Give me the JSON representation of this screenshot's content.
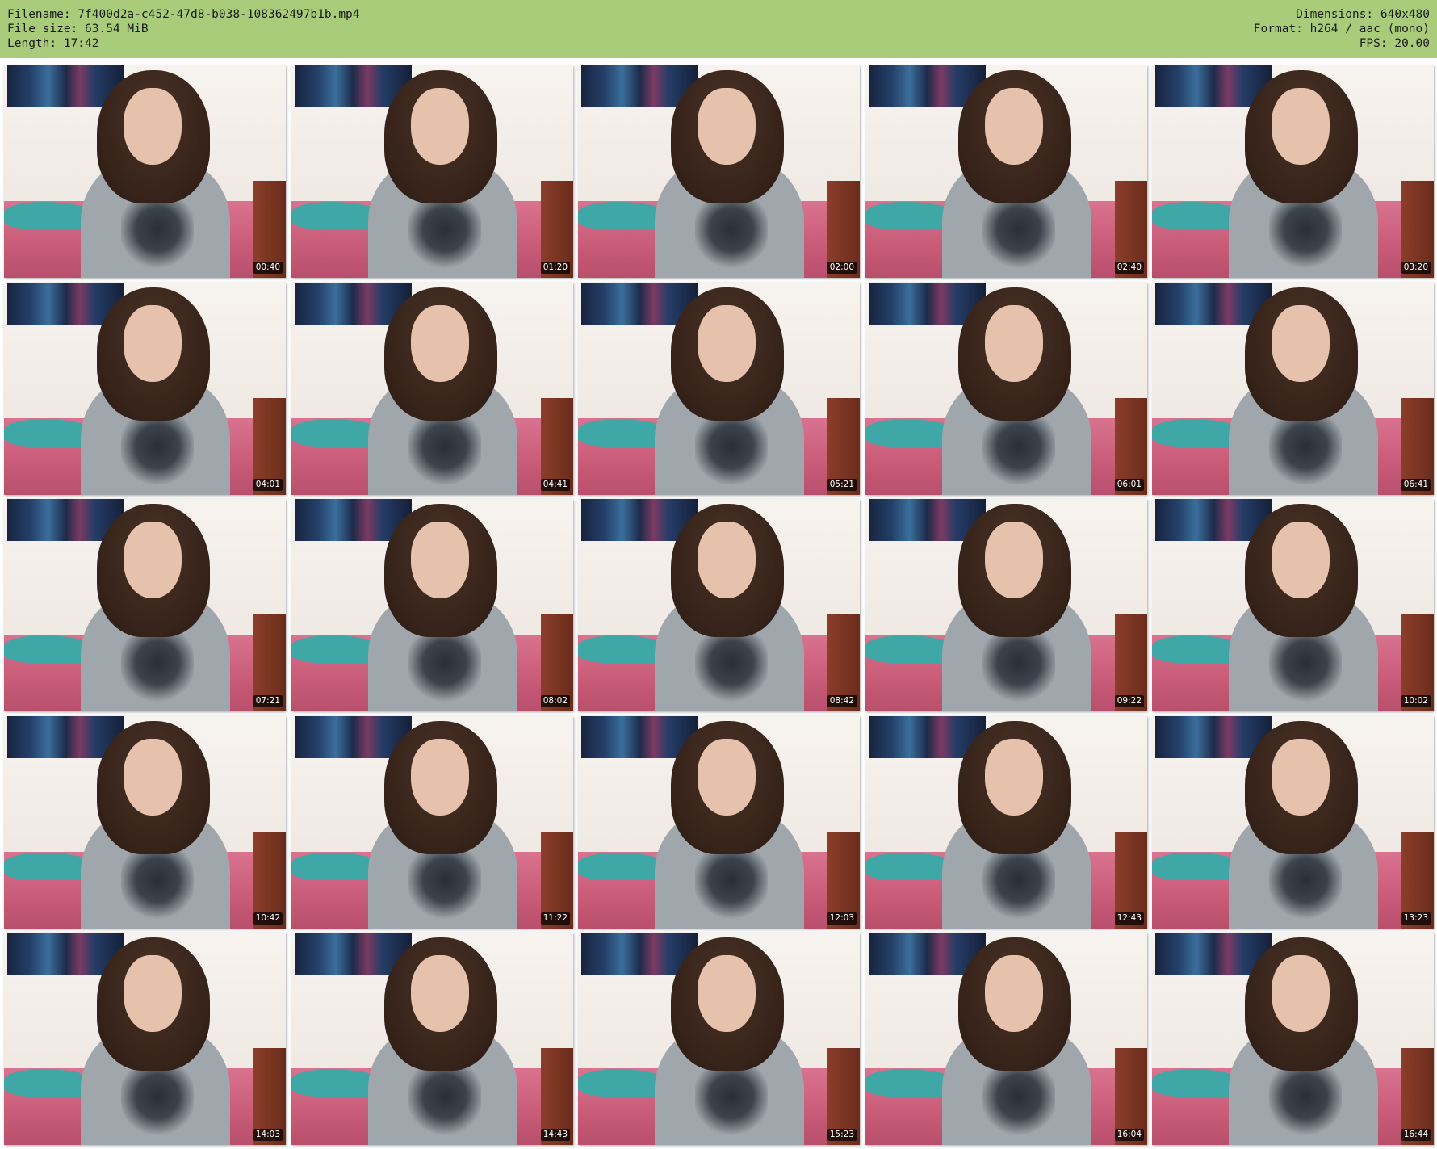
{
  "header": {
    "left": [
      {
        "label": "Filename:",
        "value": "7f400d2a-c452-47d8-b038-108362497b1b.mp4"
      },
      {
        "label": "File size:",
        "value": "63.54 MiB"
      },
      {
        "label": "Length:",
        "value": "17:42"
      }
    ],
    "right": [
      {
        "label": "Dimensions:",
        "value": "640x480"
      },
      {
        "label": "Format:",
        "value": "h264 / aac (mono)"
      },
      {
        "label": "FPS:",
        "value": "20.00"
      }
    ]
  },
  "thumbnails": [
    "00:40",
    "01:20",
    "02:00",
    "02:40",
    "03:20",
    "04:01",
    "04:41",
    "05:21",
    "06:01",
    "06:41",
    "07:21",
    "08:02",
    "08:42",
    "09:22",
    "10:02",
    "10:42",
    "11:22",
    "12:03",
    "12:43",
    "13:23",
    "14:03",
    "14:43",
    "15:23",
    "16:04",
    "16:44"
  ],
  "colors": {
    "header_bg": "#a9cc7a",
    "timestamp_bg": "#000000",
    "timestamp_fg": "#ffffff"
  }
}
